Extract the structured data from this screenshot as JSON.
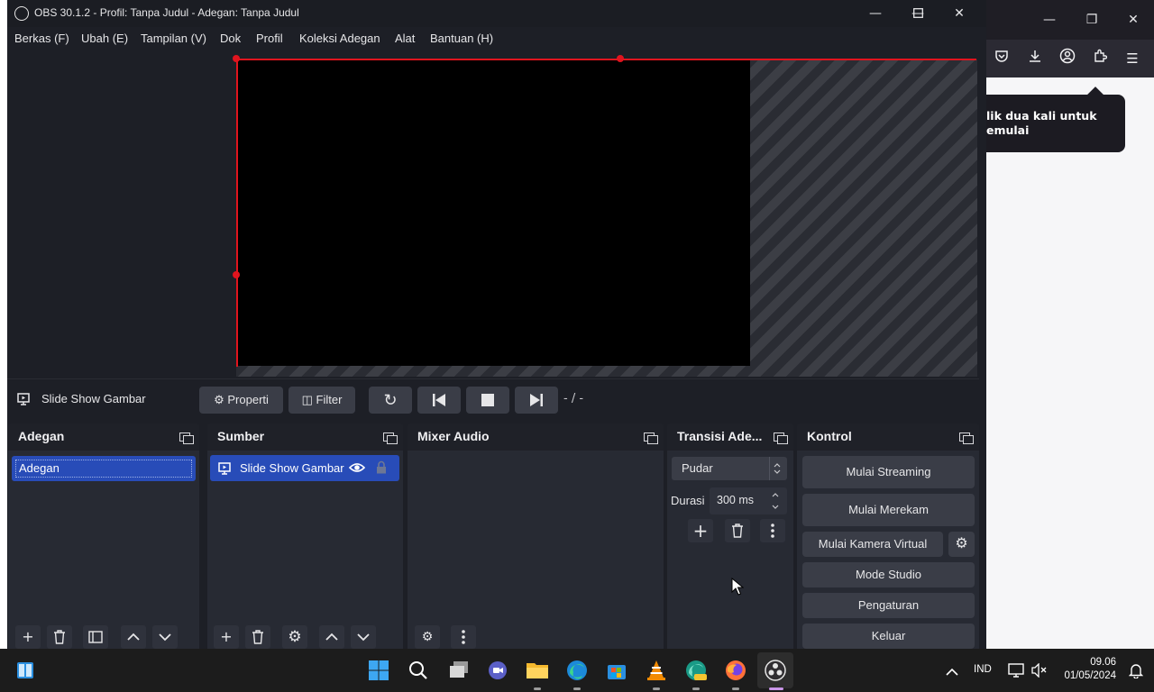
{
  "background_browser": {
    "tooltip_line1": "lik dua kali untuk",
    "tooltip_line2": "emulai"
  },
  "obs": {
    "window_title": "OBS 30.1.2 - Profil: Tanpa Judul - Adegan: Tanpa Judul",
    "menu": [
      "Berkas (F)",
      "Ubah (E)",
      "Tampilan (V)",
      "Dok",
      "Profil",
      "Koleksi Adegan",
      "Alat",
      "Bantuan (H)"
    ],
    "source_toolbar": {
      "source_name": "Slide Show Gambar",
      "properties_label": "Properti",
      "filter_label": "Filter",
      "slide_counter": "- / -"
    },
    "docks": {
      "scenes": {
        "title": "Adegan",
        "items": [
          "Adegan"
        ]
      },
      "sources": {
        "title": "Sumber",
        "items": [
          "Slide Show Gambar"
        ]
      },
      "mixer": {
        "title": "Mixer Audio"
      },
      "transitions": {
        "title": "Transisi Ade...",
        "selected": "Pudar",
        "duration_label": "Durasi",
        "duration_value": "300 ms"
      },
      "controls": {
        "title": "Kontrol",
        "start_streaming": "Mulai Streaming",
        "start_recording": "Mulai Merekam",
        "start_virtual_cam": "Mulai Kamera Virtual",
        "studio_mode": "Mode Studio",
        "settings": "Pengaturan",
        "exit": "Keluar"
      }
    }
  },
  "taskbar": {
    "language": "IND",
    "time": "09.06",
    "date": "01/05/2024"
  },
  "colors": {
    "accent_selection": "#284cb8",
    "preview_border": "#e0141e"
  }
}
